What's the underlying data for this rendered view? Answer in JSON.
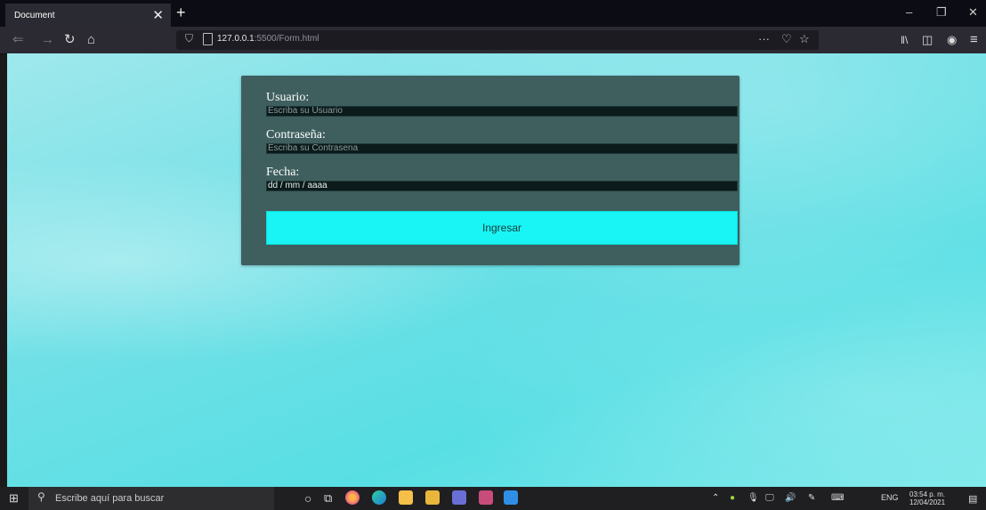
{
  "browser": {
    "tab_title": "Document",
    "tab_close": "✕",
    "new_tab": "+",
    "url_host": "127.0.0.1",
    "url_rest": ":5500/Form.html",
    "window_controls": {
      "minimize": "–",
      "restore": "❐",
      "close": "✕"
    },
    "nav_icons": [
      "back-icon",
      "forward-icon",
      "reload-icon",
      "home-icon"
    ],
    "url_icons": [
      "shield-icon",
      "page-icon",
      "more-icon",
      "pocket-icon",
      "star-icon"
    ],
    "toolbar_icons": [
      "library-icon",
      "sidebar-icon",
      "account-icon",
      "menu-icon"
    ]
  },
  "form": {
    "usuario_label": "Usuario:",
    "usuario_placeholder": "Escriba su Usuario",
    "password_label": "Contraseña:",
    "password_placeholder": "Escriba su Contrasena",
    "fecha_label": "Fecha:",
    "fecha_value": "dd / mm / aaaa",
    "submit_label": "Ingresar"
  },
  "taskbar": {
    "search_placeholder": "Escribe aquí para buscar",
    "language": "ENG",
    "time": "03:54 p. m.",
    "date": "12/04/2021",
    "apps": [
      "cortana-icon",
      "task-view-icon",
      "firefox-icon",
      "edge-icon",
      "store-icon",
      "explorer-icon",
      "teams-icon",
      "outlook-icon",
      "vscode-icon"
    ]
  },
  "colors": {
    "form_bg": "#3f5f5f",
    "button_bg": "#19f4f4",
    "page_bg": "#6fe0e6"
  }
}
